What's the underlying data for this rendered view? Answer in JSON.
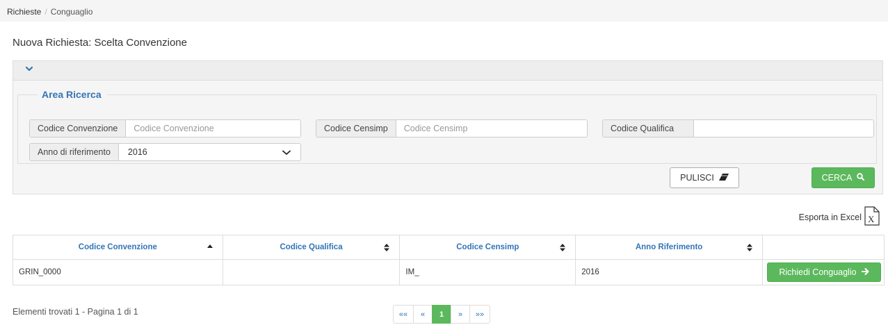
{
  "breadcrumb": {
    "root": "Richieste",
    "separator": "/",
    "current": "Conguaglio"
  },
  "page": {
    "title": "Nuova Richiesta: Scelta Convenzione"
  },
  "search": {
    "legend": "Area Ricerca",
    "codice_convenzione": {
      "label": "Codice Convenzione",
      "placeholder": "Codice Convenzione",
      "value": ""
    },
    "codice_censimp": {
      "label": "Codice Censimp",
      "placeholder": "Codice Censimp",
      "value": ""
    },
    "codice_qualifica": {
      "label": "Codice Qualifica",
      "placeholder": "",
      "value": ""
    },
    "anno_riferimento": {
      "label": "Anno di riferimento",
      "selected": "2016"
    },
    "clear_label": "PULISCI",
    "search_label": "CERCA"
  },
  "export": {
    "label": "Esporta in Excel"
  },
  "table": {
    "headers": [
      "Codice Convenzione",
      "Codice Qualifica",
      "Codice Censimp",
      "Anno Riferimento",
      ""
    ],
    "rows": [
      {
        "codice_convenzione": "GRIN_0000",
        "codice_qualifica": "",
        "codice_censimp": "IM_",
        "anno": "2016",
        "action": "Richiedi Conguaglio"
      }
    ]
  },
  "footer": {
    "summary": "Elementi trovati 1 - Pagina 1 di 1",
    "pager": {
      "first": "««",
      "prev": "«",
      "current": "1",
      "next": "»",
      "last": "»»"
    }
  },
  "colors": {
    "accent": "#3275b5",
    "success": "#5cb85c",
    "panel": "#f5f5f5"
  },
  "icons": {
    "collapse": "chevron-down-icon",
    "clear": "eraser-icon",
    "search": "search-icon",
    "excel": "excel-file-icon",
    "action": "arrow-right-icon",
    "sort": "sort-icon"
  }
}
